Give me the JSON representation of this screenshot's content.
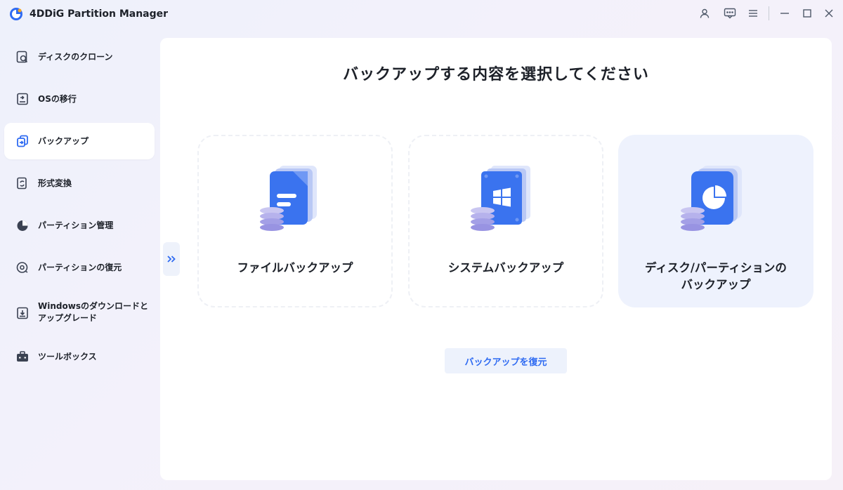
{
  "app": {
    "title": "4DDiG Partition Manager"
  },
  "titlebar": {
    "icons": [
      "user-icon",
      "feedback-icon",
      "menu-icon",
      "minimize-icon",
      "maximize-icon",
      "close-icon"
    ]
  },
  "sidebar": {
    "items": [
      {
        "label": "ディスクのクローン",
        "icon": "disk-clone-icon"
      },
      {
        "label": "OSの移行",
        "icon": "os-migrate-icon"
      },
      {
        "label": "バックアップ",
        "icon": "backup-icon",
        "active": true
      },
      {
        "label": "形式変換",
        "icon": "format-convert-icon"
      },
      {
        "label": "パーティション管理",
        "icon": "partition-manage-icon"
      },
      {
        "label": "パーティションの復元",
        "icon": "partition-restore-icon"
      },
      {
        "label_line1": "Windowsのダウンロードと",
        "label_line2": "アップグレード",
        "icon": "windows-download-icon"
      },
      {
        "label": "ツールボックス",
        "icon": "toolbox-icon"
      }
    ]
  },
  "main": {
    "title": "バックアップする内容を選択してください",
    "cards": [
      {
        "label": "ファイルバックアップ",
        "icon": "file-backup-icon"
      },
      {
        "label": "システムバックアップ",
        "icon": "system-backup-icon"
      },
      {
        "label_line1": "ディスク/パーティションの",
        "label_line2": "バックアップ",
        "icon": "disk-partition-backup-icon",
        "selected": true
      }
    ],
    "restore_button": "バックアップを復元",
    "collapse_icon": "double-chevron-right-icon"
  },
  "colors": {
    "accent": "#2f6bf2",
    "selected_card_bg": "#eef2fd",
    "active_nav_bg": "#ffffff"
  }
}
